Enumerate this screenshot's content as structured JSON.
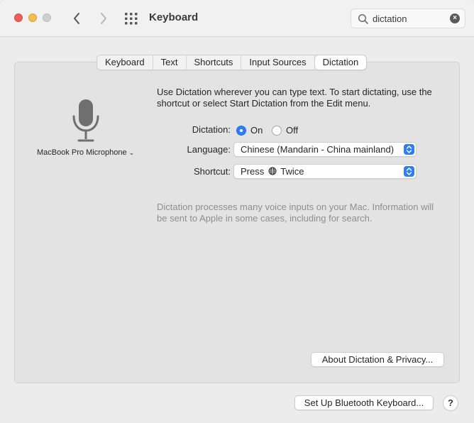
{
  "window": {
    "title": "Keyboard"
  },
  "search": {
    "value": "dictation",
    "clear_glyph": "×"
  },
  "tabs": [
    {
      "label": "Keyboard",
      "active": false
    },
    {
      "label": "Text",
      "active": false
    },
    {
      "label": "Shortcuts",
      "active": false
    },
    {
      "label": "Input Sources",
      "active": false
    },
    {
      "label": "Dictation",
      "active": true
    }
  ],
  "microphone": {
    "label": "MacBook Pro Microphone",
    "chevron": "⌄"
  },
  "intro_text": "Use Dictation wherever you can type text. To start dictating, use the shortcut or select Start Dictation from the Edit menu.",
  "dictation": {
    "label": "Dictation:",
    "on_label": "On",
    "off_label": "Off",
    "selected": "On"
  },
  "language": {
    "label": "Language:",
    "value": "Chinese (Mandarin - China mainland)"
  },
  "shortcut": {
    "label": "Shortcut:",
    "value_prefix": "Press",
    "globe_glyph": "🌐",
    "value_suffix": "Twice"
  },
  "note_text": "Dictation processes many voice inputs on your Mac. Information will be sent to Apple in some cases, including for search.",
  "buttons": {
    "about": "About Dictation & Privacy...",
    "bluetooth": "Set Up Bluetooth Keyboard...",
    "help": "?"
  },
  "colors": {
    "accent": "#2e7cf6",
    "close": "#ed5f57",
    "minimize": "#f4be4f",
    "zoom_disabled": "#cfcfcf"
  },
  "icons": [
    "back-chevron-icon",
    "forward-chevron-icon",
    "grid-icon",
    "search-icon",
    "clear-icon",
    "microphone-icon",
    "globe-icon",
    "updown-arrows-icon"
  ]
}
